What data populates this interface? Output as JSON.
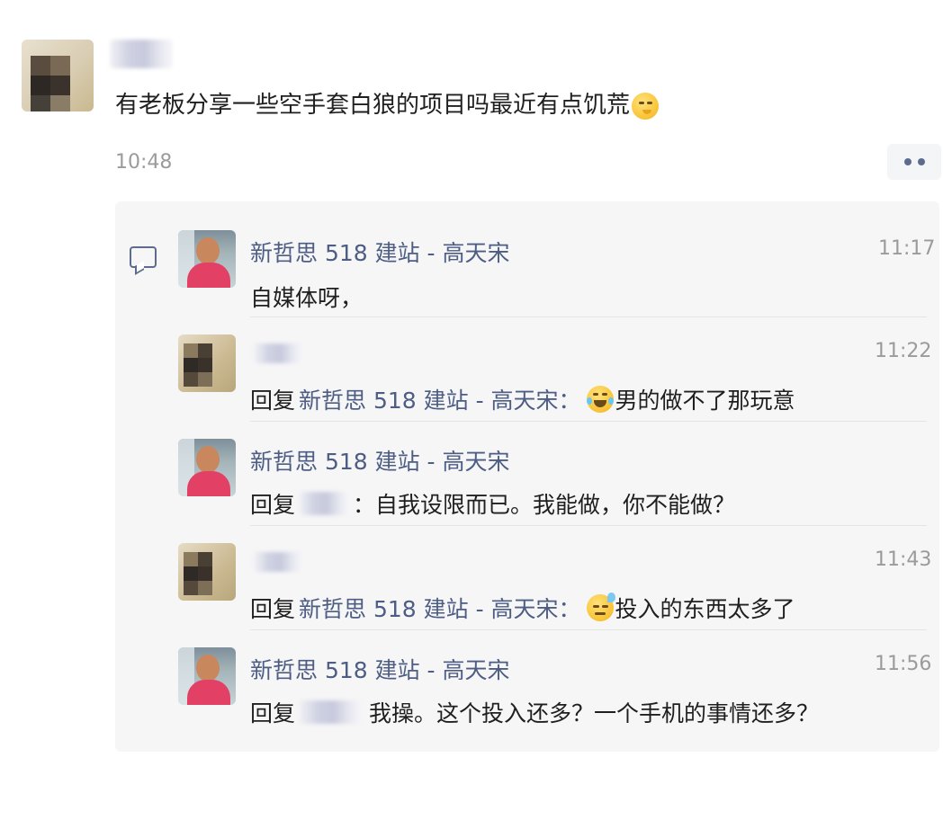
{
  "post": {
    "text": "有老板分享一些空手套白狼的项目吗最近有点饥荒",
    "emoji_icon": "face-with-hand-over-mouth-emoji",
    "time": "10:48",
    "more_icon": "more-dots-icon"
  },
  "comment_icon": "comment-bubble-icon",
  "comments": [
    {
      "author": "新哲思 518 建站 - 高天宋",
      "time": "11:17",
      "text": "自媒体呀，",
      "reply_prefix": "",
      "reply_to": "",
      "emoji": ""
    },
    {
      "author": "",
      "time": "11:22",
      "reply_prefix": "回复",
      "reply_to": "新哲思 518 建站 - 高天宋：",
      "emoji": "face-with-tears-of-joy-emoji",
      "text": "男的做不了那玩意"
    },
    {
      "author": "新哲思 518 建站 - 高天宋",
      "time": "",
      "reply_prefix": "回复",
      "reply_to": "",
      "separator": "：",
      "emoji": "",
      "text": "自我设限而已。我能做，你不能做？"
    },
    {
      "author": "",
      "time": "11:43",
      "reply_prefix": "回复",
      "reply_to": "新哲思 518 建站 - 高天宋：",
      "emoji": "downcast-face-with-sweat-emoji",
      "text": "投入的东西太多了"
    },
    {
      "author": "新哲思 518 建站 - 高天宋",
      "time": "11:56",
      "reply_prefix": "回复",
      "reply_to": "",
      "emoji": "",
      "text": "我操。这个投入还多？一个手机的事情还多？"
    }
  ]
}
